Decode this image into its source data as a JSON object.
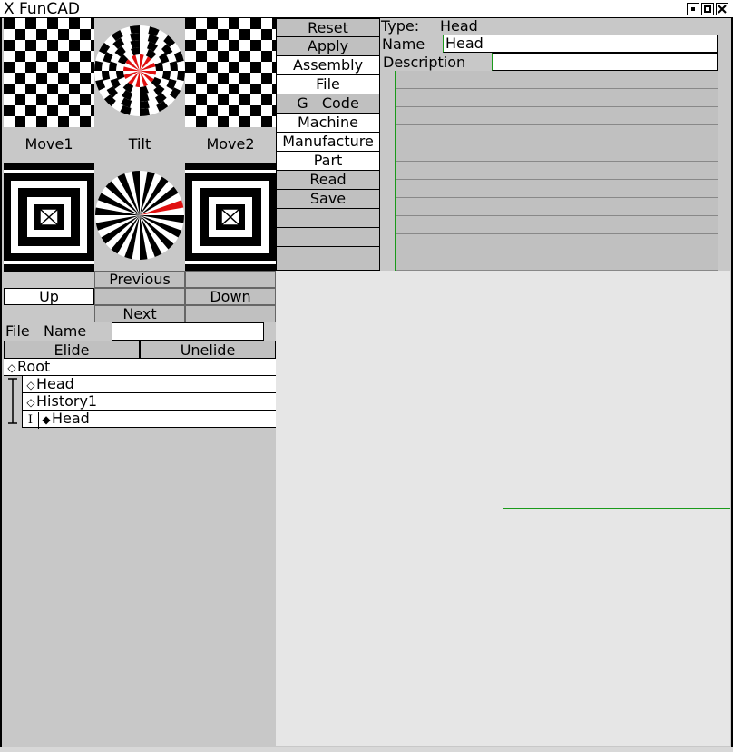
{
  "window": {
    "title": "FunCAD",
    "x_icon": "X",
    "controls": [
      "minimize-icon",
      "maximize-icon",
      "close-icon"
    ]
  },
  "icons": {
    "row1": [
      {
        "name": "move1-icon",
        "label": "Move1"
      },
      {
        "name": "tilt-icon",
        "label": "Tilt"
      },
      {
        "name": "move2-icon",
        "label": "Move2"
      }
    ]
  },
  "commands": [
    {
      "label": "Reset",
      "style": "gray"
    },
    {
      "label": "Apply",
      "style": "gray"
    },
    {
      "label": "Assembly",
      "style": "white"
    },
    {
      "label": "File",
      "style": "white"
    },
    {
      "label": "G   Code",
      "style": "gray"
    },
    {
      "label": "Machine",
      "style": "white"
    },
    {
      "label": "Manufacture",
      "style": "white"
    },
    {
      "label": "Part",
      "style": "white"
    },
    {
      "label": "Read",
      "style": "gray"
    },
    {
      "label": "Save",
      "style": "gray"
    },
    {
      "label": "",
      "style": "gray"
    },
    {
      "label": "",
      "style": "gray"
    },
    {
      "label": "",
      "style": "gray"
    }
  ],
  "properties": {
    "type_label": "Type:",
    "type_value": "Head",
    "name_label": "Name",
    "name_value": "Head",
    "description_label": "Description",
    "description_value": ""
  },
  "navigation": {
    "previous": "Previous",
    "up": "Up",
    "down": "Down",
    "next": "Next"
  },
  "file": {
    "label": "File   Name",
    "value": ""
  },
  "elide": {
    "elide": "Elide",
    "unelide": "Unelide"
  },
  "tree": {
    "root": "Root",
    "head": "Head",
    "history": "History1",
    "child": "Head",
    "bar_glyph": "I"
  },
  "colors": {
    "accent_green": "#1a9a1a",
    "highlight_red": "#e01010"
  }
}
